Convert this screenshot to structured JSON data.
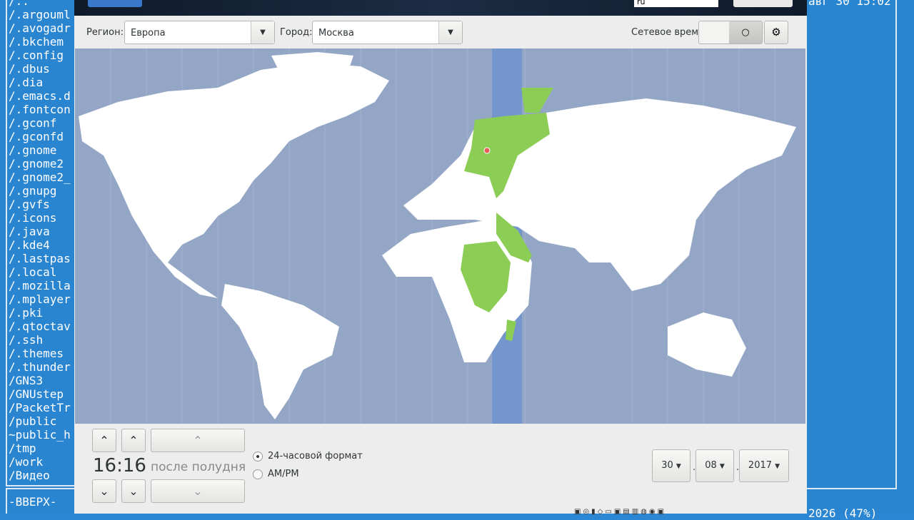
{
  "terminal": {
    "files": [
      "/..",
      "/.argouml",
      "/.avogadr",
      "/.bkchem",
      "/.config",
      "/.dbus",
      "/.dia",
      "/.emacs.d",
      "/.fontcon",
      "/.gconf",
      "/.gconfd",
      "/.gnome",
      "/.gnome2",
      "/.gnome2_",
      "/.gnupg",
      "/.gvfs",
      "/.icons",
      "/.java",
      "/.kde4",
      "/.lastpas",
      "/.local",
      "/.mozilla",
      "/.mplayer",
      "/.pki",
      "/.qtoctav",
      "/.ssh",
      "/.themes",
      "/.thunder",
      "/GNS3",
      "/GNUstep",
      "/PacketTr",
      "/public",
      "~public_h",
      "/tmp",
      "/work",
      "/Видео"
    ],
    "up_label": "-ВВЕРХ-",
    "clock": "авг 30 15:02",
    "status": "2026 (47%)"
  },
  "header": {
    "lang": "ru"
  },
  "location": {
    "region_label": "Регион:",
    "region_value": "Европа",
    "city_label": "Город:",
    "city_value": "Москва",
    "network_time_label": "Сетевое время"
  },
  "time": {
    "value": "16:16",
    "period": "после полудня",
    "format_24": "24-часовой формат",
    "format_ampm": "AM/PM",
    "selected_format": "24h"
  },
  "date": {
    "day": "30",
    "month": "08",
    "year": "2017"
  },
  "colors": {
    "ocean": "#93a6c6",
    "band": "#7596cc",
    "land": "#ffffff",
    "highlight": "#8ccd55"
  }
}
